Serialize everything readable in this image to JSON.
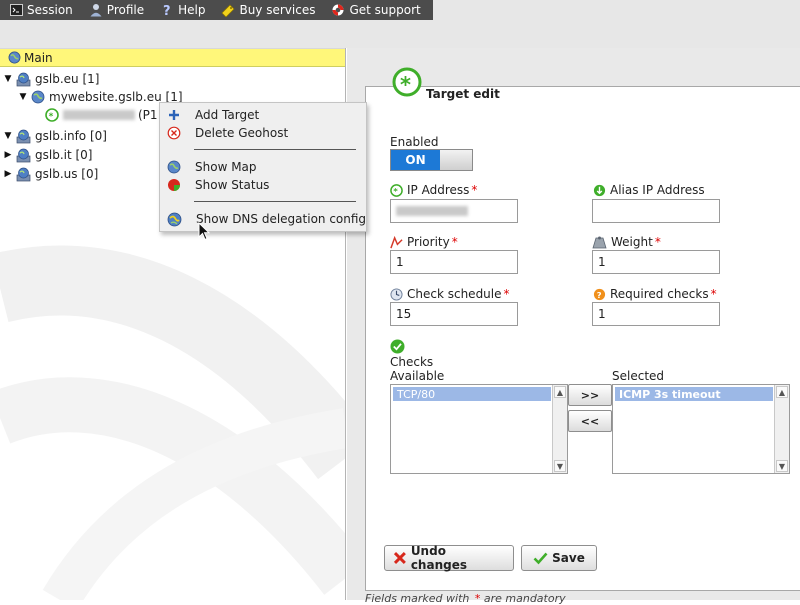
{
  "topnav": {
    "items": [
      {
        "label": "Session",
        "icon": "terminal-icon"
      },
      {
        "label": "Profile",
        "icon": "user-icon"
      },
      {
        "label": "Help",
        "icon": "help-icon"
      },
      {
        "label": "Buy services",
        "icon": "buy-icon"
      },
      {
        "label": "Get support",
        "icon": "lifebuoy-icon"
      }
    ]
  },
  "tree": {
    "header": "Main",
    "nodes": [
      {
        "label": "gslb.eu [1]",
        "expanded": true
      },
      {
        "label": "mywebsite.gslb.eu [1]",
        "expanded": true
      },
      {
        "label": "(P1",
        "expanded": false
      },
      {
        "label": "gslb.info [0]",
        "expanded": true
      },
      {
        "label": "gslb.it [0]",
        "expanded": false
      },
      {
        "label": "gslb.us [0]",
        "expanded": false
      }
    ]
  },
  "context_menu": {
    "items": [
      {
        "label": "Add Target",
        "icon": "plus-icon"
      },
      {
        "label": "Delete Geohost",
        "icon": "delete-icon"
      },
      {
        "label": "Show Map",
        "icon": "globe-icon"
      },
      {
        "label": "Show Status",
        "icon": "pie-chart-icon"
      },
      {
        "label": "Show DNS delegation config",
        "icon": "dns-globe-icon"
      }
    ]
  },
  "form": {
    "title": "Target edit",
    "enabled_label": "Enabled",
    "toggle_label": "ON",
    "ip_label": "IP Address",
    "ip_value": "",
    "alias_label": "Alias IP Address",
    "alias_value": "",
    "priority_label": "Priority",
    "priority_value": "1",
    "weight_label": "Weight",
    "weight_value": "1",
    "schedule_label": "Check schedule",
    "schedule_value": "15",
    "required_label": "Required checks",
    "required_value": "1",
    "required_mark": "*",
    "checks_label": "Checks",
    "available_label": "Available",
    "selected_label": "Selected",
    "available_items": [
      "TCP/80"
    ],
    "selected_items": [
      "ICMP 3s timeout"
    ],
    "add_button": ">>",
    "remove_button": "<<",
    "undo_button": "Undo changes",
    "save_button": "Save",
    "footer_pre": "Fields marked with",
    "footer_post": "are mandatory"
  },
  "colors": {
    "topnav_bg": "#4c4c4c",
    "tree_header_bg": "#fff77a",
    "toggle_on": "#1d79d6",
    "selection": "#9cb8e6",
    "required": "#dd0000"
  }
}
